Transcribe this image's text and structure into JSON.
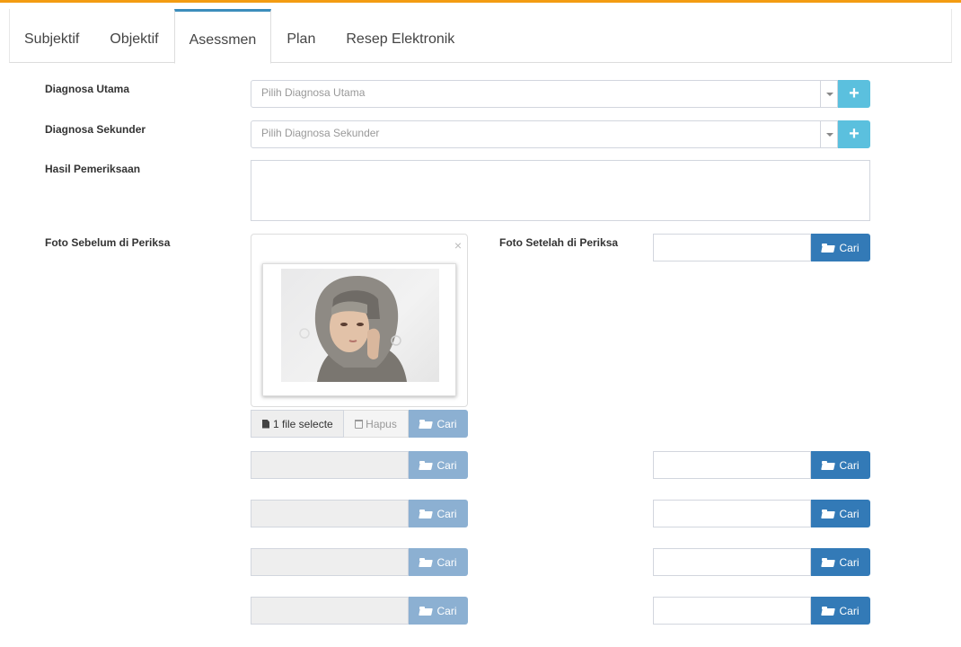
{
  "tabs": [
    "Subjektif",
    "Objektif",
    "Asessmen",
    "Plan",
    "Resep Elektronik"
  ],
  "form": {
    "diagnosa_utama_label": "Diagnosa Utama",
    "diagnosa_utama_placeholder": "Pilih Diagnosa Utama",
    "diagnosa_sekunder_label": "Diagnosa Sekunder",
    "diagnosa_sekunder_placeholder": "Pilih Diagnosa Sekunder",
    "hasil_label": "Hasil Pemeriksaan",
    "foto_sebelum_label": "Foto Sebelum di Periksa",
    "foto_setelah_label": "Foto Setelah di Periksa",
    "file_caption": "1 file selecte",
    "hapus_label": "Hapus",
    "cari_label": "Cari",
    "close_symbol": "×",
    "plus_symbol": "+"
  },
  "colors": {
    "accent_top": "#f39c12",
    "tab_active": "#3c8dbc",
    "btn_info": "#5bc0de",
    "btn_primary": "#337ab7"
  }
}
